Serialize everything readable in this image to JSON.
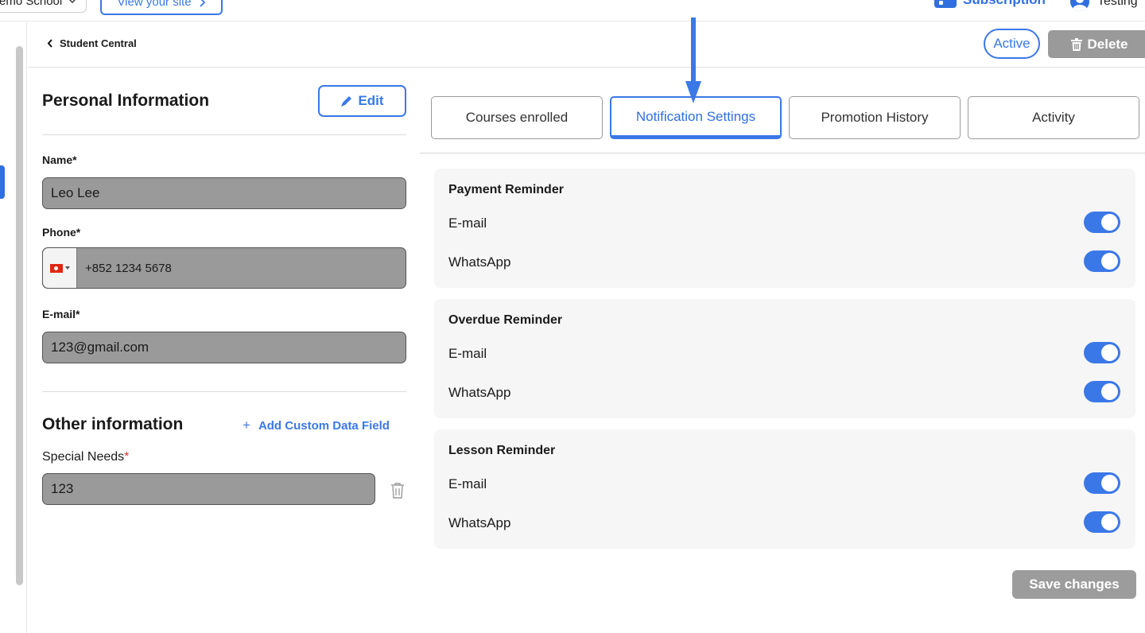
{
  "topbar": {
    "school_select": "emo School",
    "view_site": "View your site",
    "subscription": "Subscription",
    "user_name": "Testing"
  },
  "header": {
    "back_label": "Student Central",
    "status": "Active",
    "delete_label": "Delete"
  },
  "personal": {
    "title": "Personal Information",
    "edit_label": "Edit",
    "name_label": "Name*",
    "name_value": "Leo Lee",
    "phone_label": "Phone*",
    "phone_value": "+852 1234 5678",
    "email_label": "E-mail*",
    "email_value": "123@gmail.com"
  },
  "other": {
    "title": "Other information",
    "add_field": "Add Custom Data Field",
    "special_label": "Special Needs",
    "special_req": "*",
    "special_value": "123"
  },
  "tabs": [
    "Courses enrolled",
    "Notification Settings",
    "Promotion History",
    "Activity"
  ],
  "active_tab": "Notification Settings",
  "notifications": [
    {
      "title": "Payment Reminder",
      "email_label": "E-mail",
      "email_on": true,
      "whatsapp_label": "WhatsApp",
      "whatsapp_on": true
    },
    {
      "title": "Overdue Reminder",
      "email_label": "E-mail",
      "email_on": true,
      "whatsapp_label": "WhatsApp",
      "whatsapp_on": true
    },
    {
      "title": "Lesson Reminder",
      "email_label": "E-mail",
      "email_on": true,
      "whatsapp_label": "WhatsApp",
      "whatsapp_on": true
    }
  ],
  "save_label": "Save changes",
  "colors": {
    "accent": "#3b78e7",
    "disabled": "#9a9a9a",
    "card_bg": "#f6f6f6"
  }
}
